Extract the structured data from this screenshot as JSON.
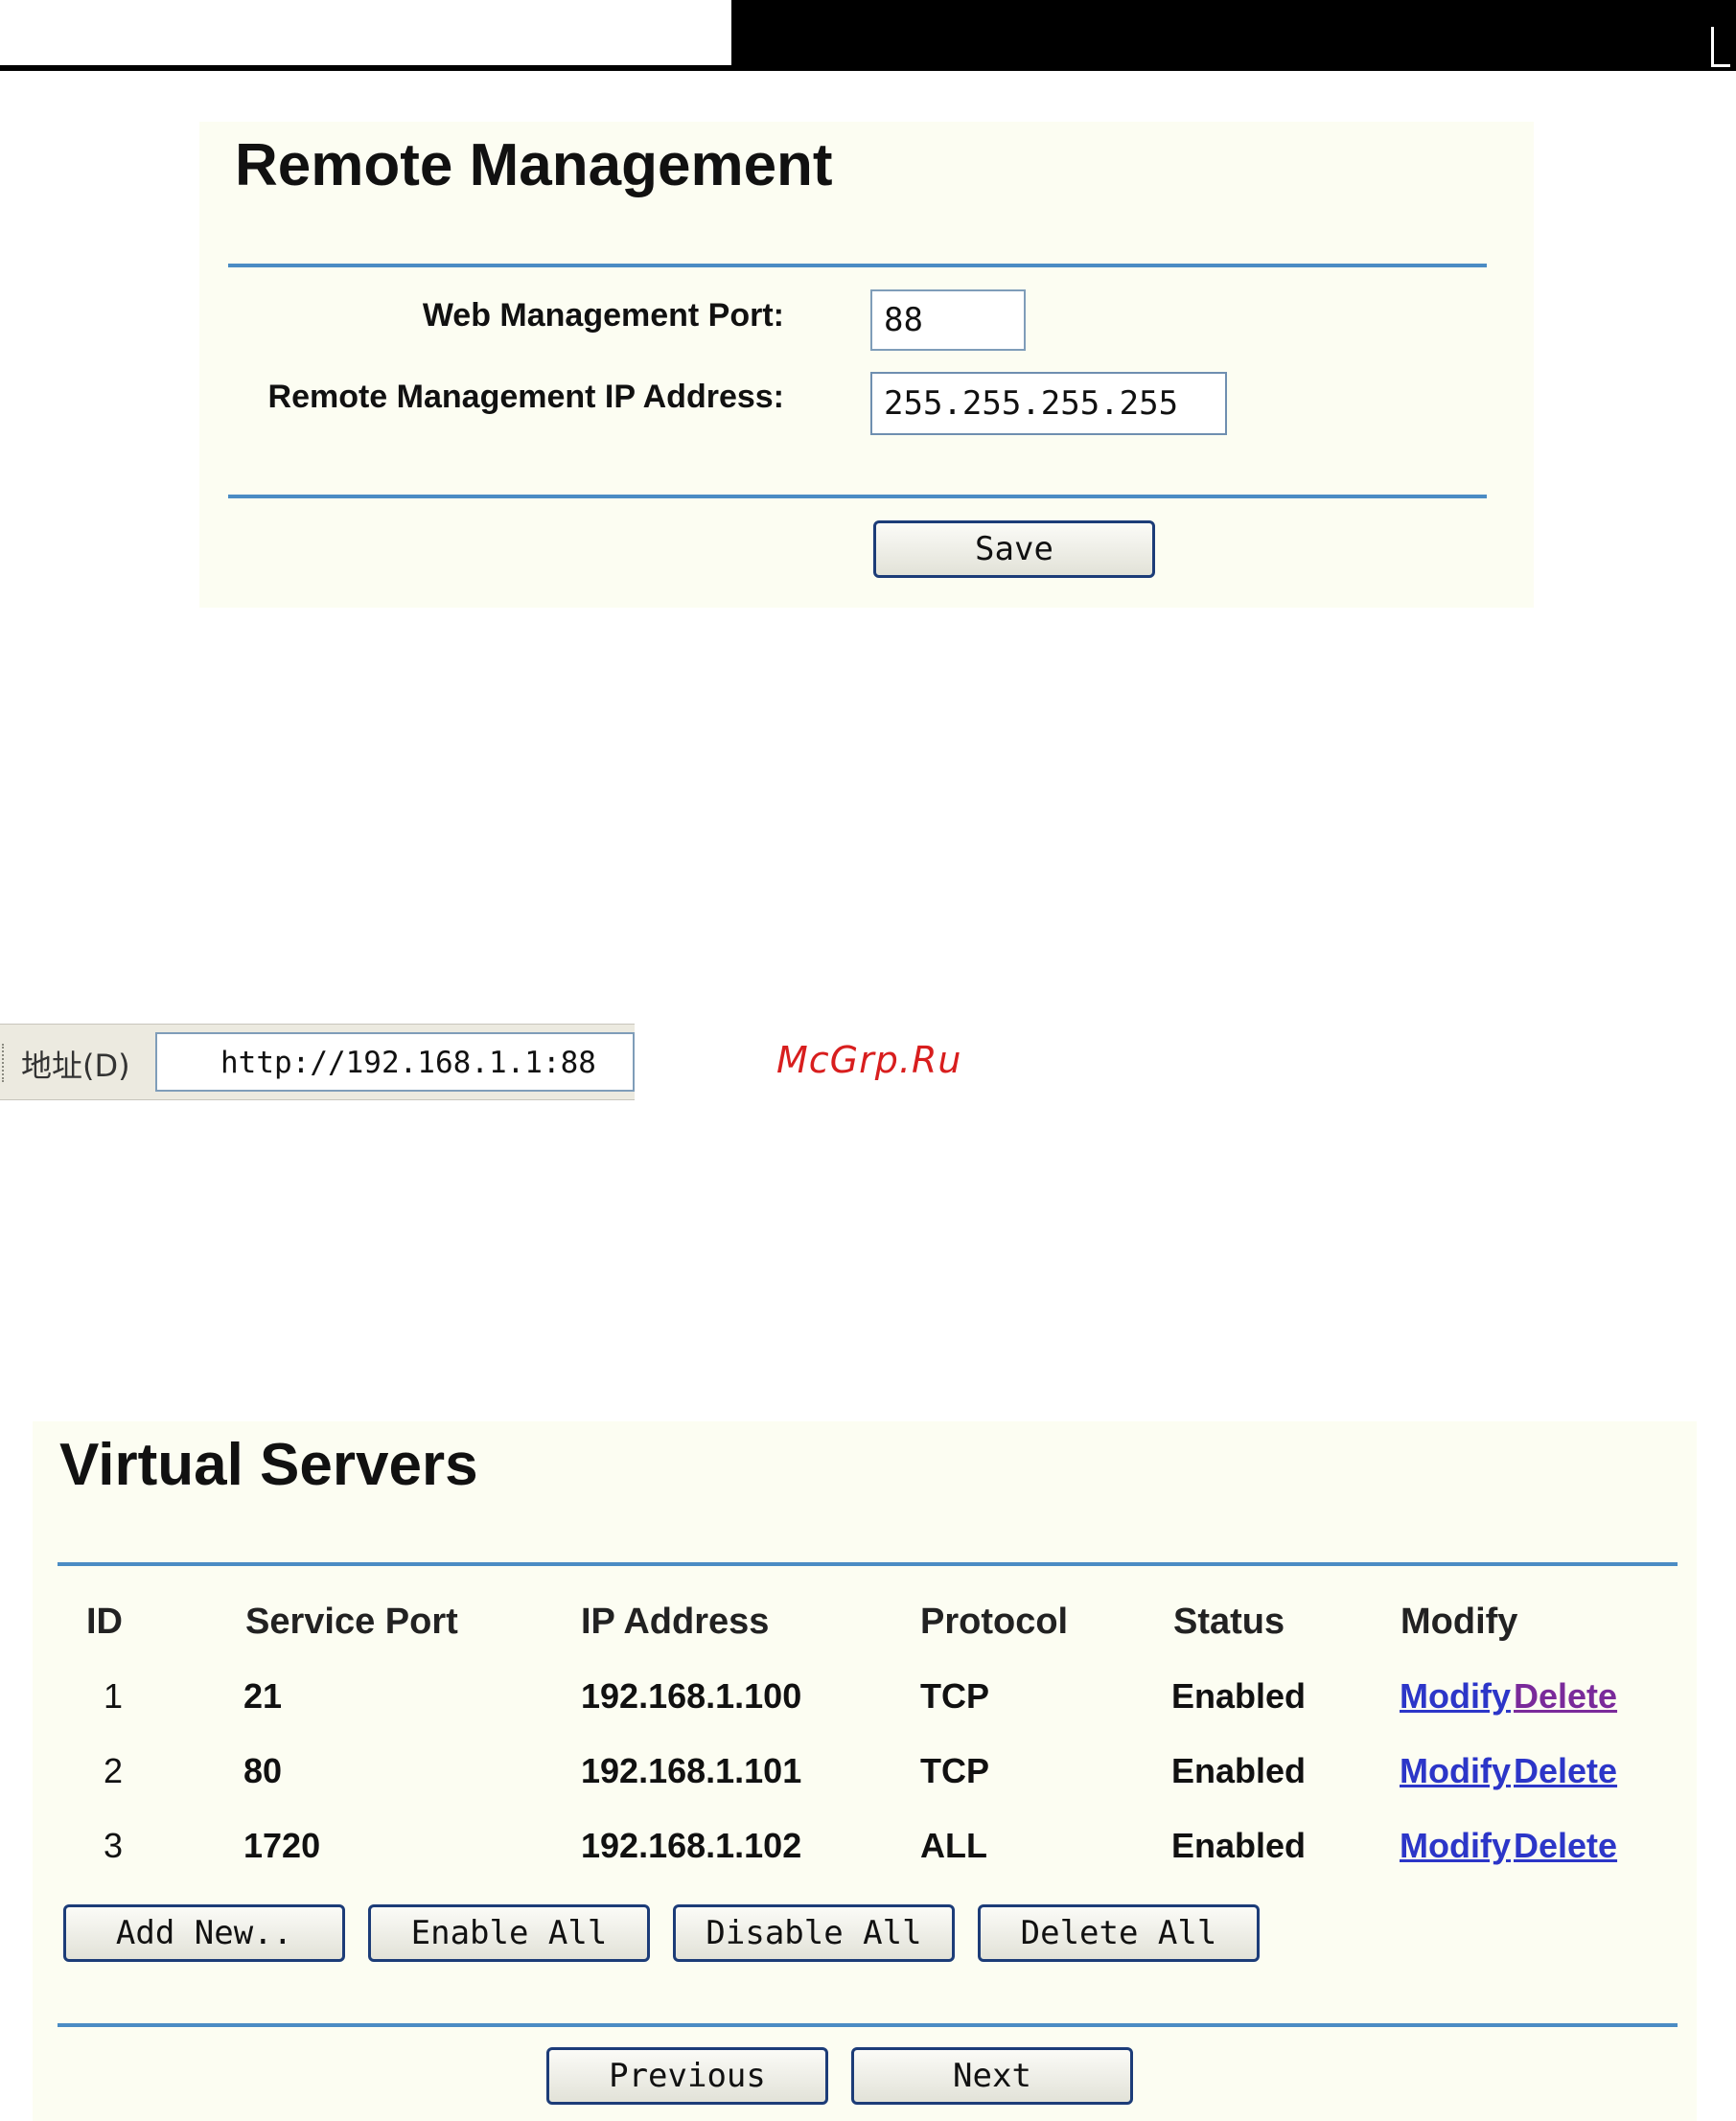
{
  "remote_management": {
    "title": "Remote Management",
    "web_port_label": "Web Management Port:",
    "web_port_value": "88",
    "remote_ip_label": "Remote Management IP Address:",
    "remote_ip_value": "255.255.255.255",
    "save_label": "Save"
  },
  "address_bar": {
    "label": "地址(D)",
    "url": "http://192.168.1.1:88"
  },
  "watermark": "McGrp.Ru",
  "virtual_servers": {
    "title": "Virtual Servers",
    "columns": [
      "ID",
      "Service Port",
      "IP Address",
      "Protocol",
      "Status",
      "Modify"
    ],
    "rows": [
      {
        "id": "1",
        "service_port": "21",
        "ip": "192.168.1.100",
        "protocol": "TCP",
        "status": "Enabled",
        "modify_label": "Modify",
        "delete_label": "Delete"
      },
      {
        "id": "2",
        "service_port": "80",
        "ip": "192.168.1.101",
        "protocol": "TCP",
        "status": "Enabled",
        "modify_label": "Modify",
        "delete_label": "Delete"
      },
      {
        "id": "3",
        "service_port": "1720",
        "ip": "192.168.1.102",
        "protocol": "ALL",
        "status": "Enabled",
        "modify_label": "Modify",
        "delete_label": "Delete"
      }
    ],
    "buttons": {
      "add_new": "Add New..",
      "enable_all": "Enable All",
      "disable_all": "Disable All",
      "delete_all": "Delete All",
      "previous": "Previous",
      "next": "Next"
    },
    "link_color": "#2c36c8",
    "visited_link_color": "#7a2a9a",
    "rule_color": "#4b8cc4"
  }
}
